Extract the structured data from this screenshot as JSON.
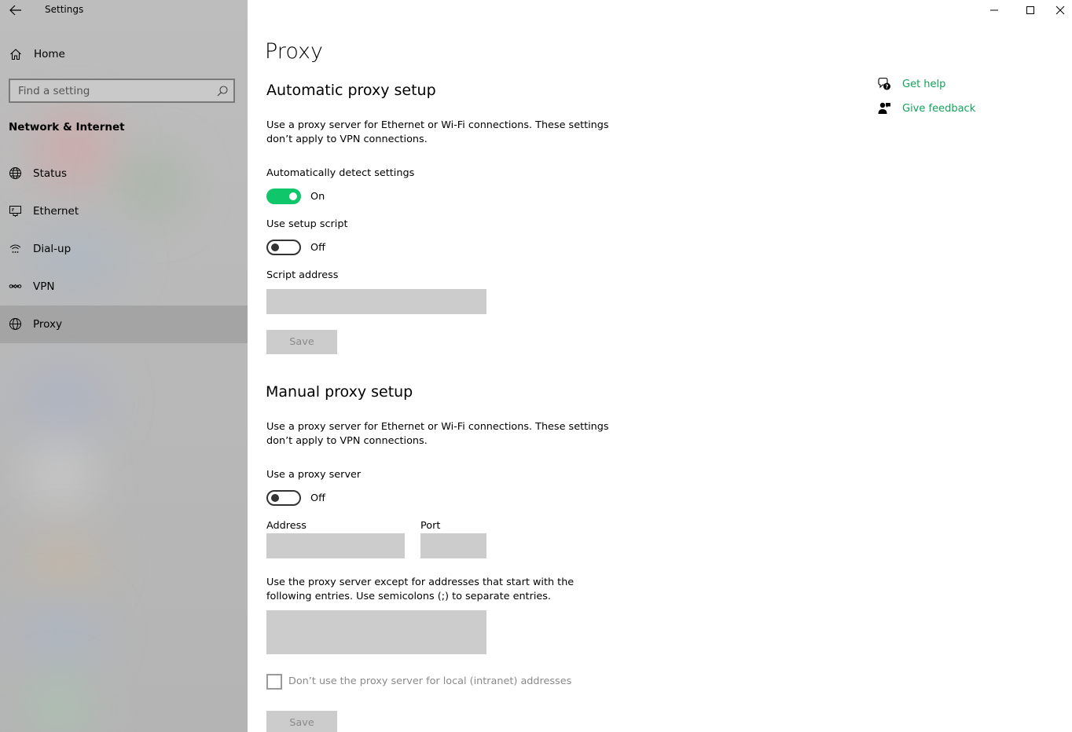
{
  "window": {
    "title": "Settings",
    "minimize_icon": "minimize-icon",
    "maximize_icon": "maximize-icon",
    "close_icon": "close-icon"
  },
  "sidebar": {
    "home_label": "Home",
    "search_placeholder": "Find a setting",
    "section_title": "Network & Internet",
    "items": [
      {
        "label": "Status",
        "icon": "globe-status-icon"
      },
      {
        "label": "Ethernet",
        "icon": "ethernet-icon"
      },
      {
        "label": "Dial-up",
        "icon": "dialup-icon"
      },
      {
        "label": "VPN",
        "icon": "vpn-icon"
      },
      {
        "label": "Proxy",
        "icon": "globe-icon",
        "selected": true
      }
    ]
  },
  "main": {
    "title": "Proxy",
    "automatic": {
      "heading": "Automatic proxy setup",
      "description": "Use a proxy server for Ethernet or Wi-Fi connections. These settings don’t apply to VPN connections.",
      "detect_label": "Automatically detect settings",
      "detect_state": "On",
      "script_label": "Use setup script",
      "script_state": "Off",
      "address_label": "Script address",
      "address_value": "",
      "save_label": "Save"
    },
    "manual": {
      "heading": "Manual proxy setup",
      "description": "Use a proxy server for Ethernet or Wi-Fi connections. These settings don’t apply to VPN connections.",
      "use_proxy_label": "Use a proxy server",
      "use_proxy_state": "Off",
      "address_label": "Address",
      "address_value": "",
      "port_label": "Port",
      "port_value": "",
      "exceptions_description": "Use the proxy server except for addresses that start with the following entries. Use semicolons (;) to separate entries.",
      "exceptions_value": "",
      "local_checkbox_label": "Don’t use the proxy server for local (intranet) addresses",
      "local_checked": false,
      "save_label": "Save"
    }
  },
  "help": {
    "get_help": "Get help",
    "give_feedback": "Give feedback"
  },
  "colors": {
    "accent": "#10c66a",
    "link": "#10a35a",
    "sidebar_bg": "#bababa",
    "disabled_field": "#cccccc"
  }
}
